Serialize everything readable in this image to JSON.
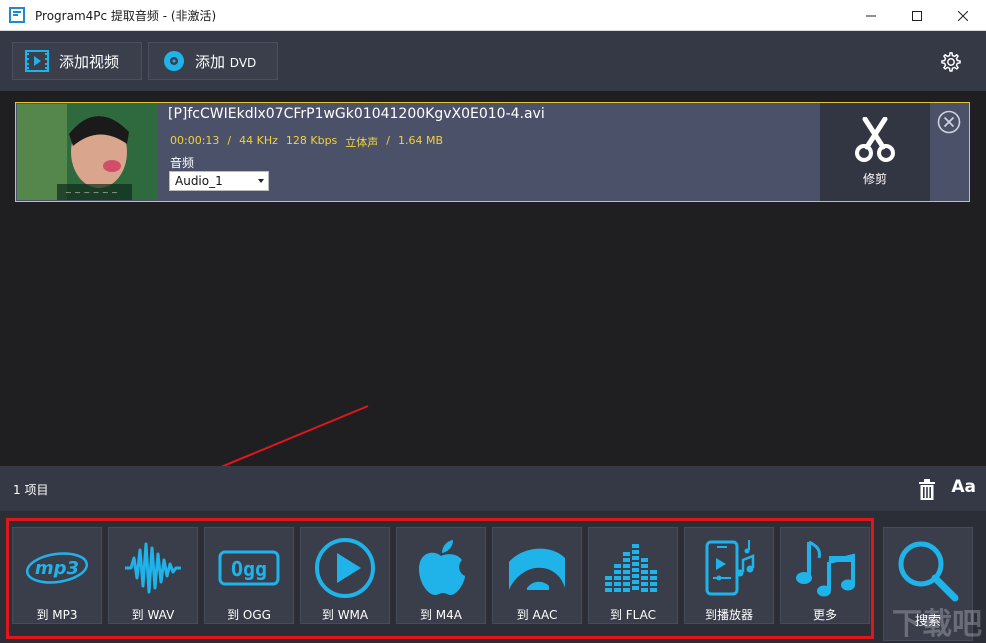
{
  "window": {
    "title": "Program4Pc 提取音频 - (非激活)"
  },
  "toolbar": {
    "add_video": "添加视频",
    "add_dvd_main": "添加",
    "add_dvd_sub": "DVD"
  },
  "file": {
    "name": "[P]fcCWIEkdlx07CFrP1wGk01041200KgvX0E010-4.avi",
    "duration": "00:00:13",
    "sample_rate": "44 KHz",
    "bitrate": "128 Kbps",
    "channels": "立体声",
    "size": "1.64 MB",
    "sep": "/",
    "audio_label": "音频",
    "audio_track": "Audio_1",
    "trim_label": "修剪"
  },
  "status": {
    "item_count": "1 项目",
    "font_button": "Aa"
  },
  "formats": [
    {
      "label": "到 MP3",
      "icon": "mp3-icon"
    },
    {
      "label": "到 WAV",
      "icon": "waveform-icon"
    },
    {
      "label": "到 OGG",
      "icon": "ogg-icon"
    },
    {
      "label": "到 WMA",
      "icon": "play-circle-icon"
    },
    {
      "label": "到 M4A",
      "icon": "apple-icon"
    },
    {
      "label": "到 AAC",
      "icon": "aac-icon"
    },
    {
      "label": "到 FLAC",
      "icon": "equalizer-icon"
    },
    {
      "label": "到播放器",
      "icon": "phone-music-icon"
    },
    {
      "label": "更多",
      "icon": "music-notes-icon"
    }
  ],
  "search": {
    "label": "搜索"
  },
  "watermark": "下载吧",
  "colors": {
    "accent": "#1fb3ea",
    "highlight_border": "#e0c43a",
    "annotation_red": "#e1161b",
    "meta_text": "#f2d23a"
  }
}
